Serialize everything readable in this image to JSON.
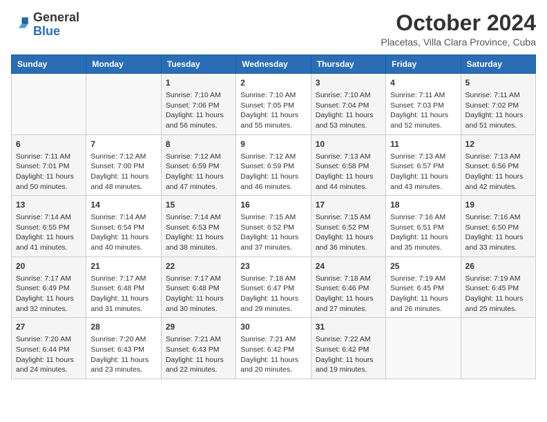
{
  "header": {
    "logo_general": "General",
    "logo_blue": "Blue",
    "month_title": "October 2024",
    "location": "Placetas, Villa Clara Province, Cuba"
  },
  "days_of_week": [
    "Sunday",
    "Monday",
    "Tuesday",
    "Wednesday",
    "Thursday",
    "Friday",
    "Saturday"
  ],
  "weeks": [
    [
      {
        "day": "",
        "info": ""
      },
      {
        "day": "",
        "info": ""
      },
      {
        "day": "1",
        "info": "Sunrise: 7:10 AM\nSunset: 7:06 PM\nDaylight: 11 hours and 56 minutes."
      },
      {
        "day": "2",
        "info": "Sunrise: 7:10 AM\nSunset: 7:05 PM\nDaylight: 11 hours and 55 minutes."
      },
      {
        "day": "3",
        "info": "Sunrise: 7:10 AM\nSunset: 7:04 PM\nDaylight: 11 hours and 53 minutes."
      },
      {
        "day": "4",
        "info": "Sunrise: 7:11 AM\nSunset: 7:03 PM\nDaylight: 11 hours and 52 minutes."
      },
      {
        "day": "5",
        "info": "Sunrise: 7:11 AM\nSunset: 7:02 PM\nDaylight: 11 hours and 51 minutes."
      }
    ],
    [
      {
        "day": "6",
        "info": "Sunrise: 7:11 AM\nSunset: 7:01 PM\nDaylight: 11 hours and 50 minutes."
      },
      {
        "day": "7",
        "info": "Sunrise: 7:12 AM\nSunset: 7:00 PM\nDaylight: 11 hours and 48 minutes."
      },
      {
        "day": "8",
        "info": "Sunrise: 7:12 AM\nSunset: 6:59 PM\nDaylight: 11 hours and 47 minutes."
      },
      {
        "day": "9",
        "info": "Sunrise: 7:12 AM\nSunset: 6:59 PM\nDaylight: 11 hours and 46 minutes."
      },
      {
        "day": "10",
        "info": "Sunrise: 7:13 AM\nSunset: 6:58 PM\nDaylight: 11 hours and 44 minutes."
      },
      {
        "day": "11",
        "info": "Sunrise: 7:13 AM\nSunset: 6:57 PM\nDaylight: 11 hours and 43 minutes."
      },
      {
        "day": "12",
        "info": "Sunrise: 7:13 AM\nSunset: 6:56 PM\nDaylight: 11 hours and 42 minutes."
      }
    ],
    [
      {
        "day": "13",
        "info": "Sunrise: 7:14 AM\nSunset: 6:55 PM\nDaylight: 11 hours and 41 minutes."
      },
      {
        "day": "14",
        "info": "Sunrise: 7:14 AM\nSunset: 6:54 PM\nDaylight: 11 hours and 40 minutes."
      },
      {
        "day": "15",
        "info": "Sunrise: 7:14 AM\nSunset: 6:53 PM\nDaylight: 11 hours and 38 minutes."
      },
      {
        "day": "16",
        "info": "Sunrise: 7:15 AM\nSunset: 6:52 PM\nDaylight: 11 hours and 37 minutes."
      },
      {
        "day": "17",
        "info": "Sunrise: 7:15 AM\nSunset: 6:52 PM\nDaylight: 11 hours and 36 minutes."
      },
      {
        "day": "18",
        "info": "Sunrise: 7:16 AM\nSunset: 6:51 PM\nDaylight: 11 hours and 35 minutes."
      },
      {
        "day": "19",
        "info": "Sunrise: 7:16 AM\nSunset: 6:50 PM\nDaylight: 11 hours and 33 minutes."
      }
    ],
    [
      {
        "day": "20",
        "info": "Sunrise: 7:17 AM\nSunset: 6:49 PM\nDaylight: 11 hours and 32 minutes."
      },
      {
        "day": "21",
        "info": "Sunrise: 7:17 AM\nSunset: 6:48 PM\nDaylight: 11 hours and 31 minutes."
      },
      {
        "day": "22",
        "info": "Sunrise: 7:17 AM\nSunset: 6:48 PM\nDaylight: 11 hours and 30 minutes."
      },
      {
        "day": "23",
        "info": "Sunrise: 7:18 AM\nSunset: 6:47 PM\nDaylight: 11 hours and 29 minutes."
      },
      {
        "day": "24",
        "info": "Sunrise: 7:18 AM\nSunset: 6:46 PM\nDaylight: 11 hours and 27 minutes."
      },
      {
        "day": "25",
        "info": "Sunrise: 7:19 AM\nSunset: 6:45 PM\nDaylight: 11 hours and 26 minutes."
      },
      {
        "day": "26",
        "info": "Sunrise: 7:19 AM\nSunset: 6:45 PM\nDaylight: 11 hours and 25 minutes."
      }
    ],
    [
      {
        "day": "27",
        "info": "Sunrise: 7:20 AM\nSunset: 6:44 PM\nDaylight: 11 hours and 24 minutes."
      },
      {
        "day": "28",
        "info": "Sunrise: 7:20 AM\nSunset: 6:43 PM\nDaylight: 11 hours and 23 minutes."
      },
      {
        "day": "29",
        "info": "Sunrise: 7:21 AM\nSunset: 6:43 PM\nDaylight: 11 hours and 22 minutes."
      },
      {
        "day": "30",
        "info": "Sunrise: 7:21 AM\nSunset: 6:42 PM\nDaylight: 11 hours and 20 minutes."
      },
      {
        "day": "31",
        "info": "Sunrise: 7:22 AM\nSunset: 6:42 PM\nDaylight: 11 hours and 19 minutes."
      },
      {
        "day": "",
        "info": ""
      },
      {
        "day": "",
        "info": ""
      }
    ]
  ]
}
